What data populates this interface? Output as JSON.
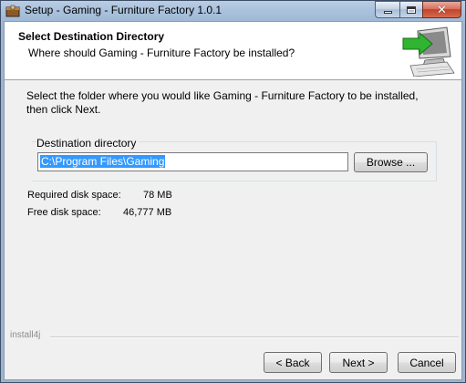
{
  "window": {
    "title": "Setup - Gaming - Furniture Factory 1.0.1",
    "icons": {
      "app": "installer-box-icon",
      "minimize": "minimize-icon",
      "maximize": "maximize-icon",
      "close": "close-icon"
    }
  },
  "header": {
    "title": "Select Destination Directory",
    "subtitle": "Where should Gaming - Furniture Factory be installed?",
    "logo_icon": "computer-install-arrow-icon"
  },
  "body": {
    "instruction": "Select the folder where you would like Gaming - Furniture Factory to be installed, then click Next.",
    "destination_group_label": "Destination directory",
    "destination_value": "C:\\Program Files\\Gaming",
    "browse_label": "Browse ...",
    "required_label": "Required disk space:",
    "required_value": "78 MB",
    "free_label": "Free disk space:",
    "free_value": "46,777 MB"
  },
  "footer": {
    "brand": "install4j",
    "back_label": "< Back",
    "next_label": "Next >",
    "cancel_label": "Cancel"
  },
  "colors": {
    "selection": "#3399ff",
    "close_button": "#c0432b",
    "titlebar": "#a9c1dc"
  }
}
